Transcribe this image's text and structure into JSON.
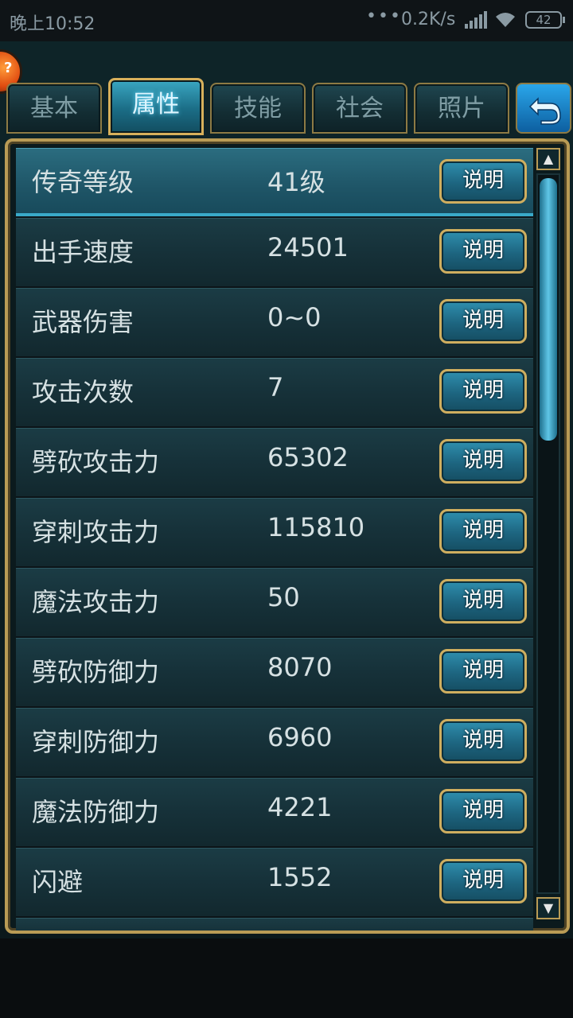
{
  "status_bar": {
    "time": "晚上10:52",
    "dots": "•••",
    "network_speed": "0.2K/s",
    "battery": "42"
  },
  "tabs": [
    {
      "label": "基本",
      "active": false
    },
    {
      "label": "属性",
      "active": true
    },
    {
      "label": "技能",
      "active": false
    },
    {
      "label": "社会",
      "active": false
    },
    {
      "label": "照片",
      "active": false
    }
  ],
  "back_icon": "return-arrow-icon",
  "explain_label": "说明",
  "attributes": [
    {
      "label": "传奇等级",
      "value": "41级",
      "selected": true
    },
    {
      "label": "出手速度",
      "value": "24501"
    },
    {
      "label": "武器伤害",
      "value": "0~0"
    },
    {
      "label": "攻击次数",
      "value": "7"
    },
    {
      "label": "劈砍攻击力",
      "value": "65302"
    },
    {
      "label": "穿刺攻击力",
      "value": "115810"
    },
    {
      "label": "魔法攻击力",
      "value": "50"
    },
    {
      "label": "劈砍防御力",
      "value": "8070"
    },
    {
      "label": "穿刺防御力",
      "value": "6960"
    },
    {
      "label": "魔法防御力",
      "value": "4221"
    },
    {
      "label": "闪避",
      "value": "1552"
    }
  ],
  "scrollbar": {
    "up_icon": "▲",
    "down_icon": "▼"
  },
  "colors": {
    "accent_gold": "#cfae5f",
    "accent_blue": "#39a9c8"
  }
}
